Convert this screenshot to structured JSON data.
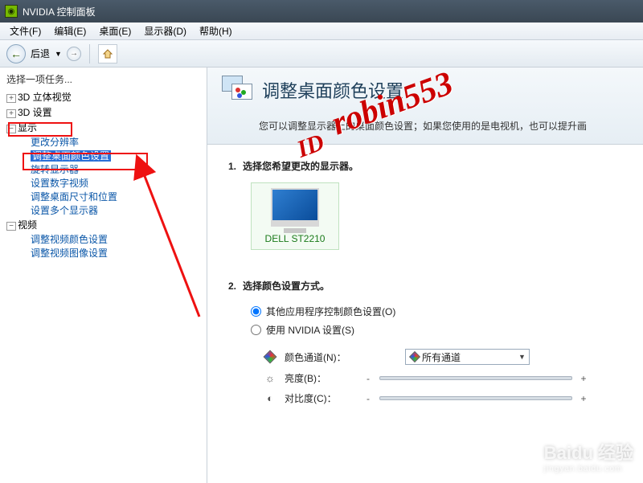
{
  "window": {
    "title": "NVIDIA 控制面板"
  },
  "menu": {
    "file": "文件(F)",
    "edit": "编辑(E)",
    "desktop": "桌面(E)",
    "display": "显示器(D)",
    "help": "帮助(H)"
  },
  "toolbar": {
    "back": "后退"
  },
  "sidebar": {
    "task_label": "选择一项任务...",
    "groups": {
      "g3d_stereo": "3D 立体视觉",
      "g3d_settings": "3D 设置",
      "display": "显示",
      "video": "视频"
    },
    "display_children": {
      "change_res": "更改分辨率",
      "adjust_color": "调整桌面颜色设置",
      "rotate": "旋转显示器",
      "digital_video": "设置数字视频",
      "size_pos": "调整桌面尺寸和位置",
      "multi": "设置多个显示器"
    },
    "video_children": {
      "video_color": "调整视频颜色设置",
      "video_image": "调整视频图像设置"
    }
  },
  "content": {
    "title": "调整桌面颜色设置",
    "desc": "您可以调整显示器上的桌面颜色设置；如果您使用的是电视机，也可以提升画",
    "step1_title": "选择您希望更改的显示器。",
    "step2_title": "选择颜色设置方式。",
    "monitor_name": "DELL ST2210",
    "radio_other": "其他应用程序控制颜色设置(O)",
    "radio_nvidia": "使用 NVIDIA 设置(S)",
    "channel_label": "颜色通道(N)：",
    "channel_value": "所有通道",
    "brightness_label": "亮度(B)：",
    "contrast_label": "对比度(C)："
  },
  "watermark": {
    "id_text": "ID",
    "name_text": "robin553"
  },
  "baidu": {
    "brand": "Baidu 经验",
    "url": "jingyan.baidu.com"
  }
}
